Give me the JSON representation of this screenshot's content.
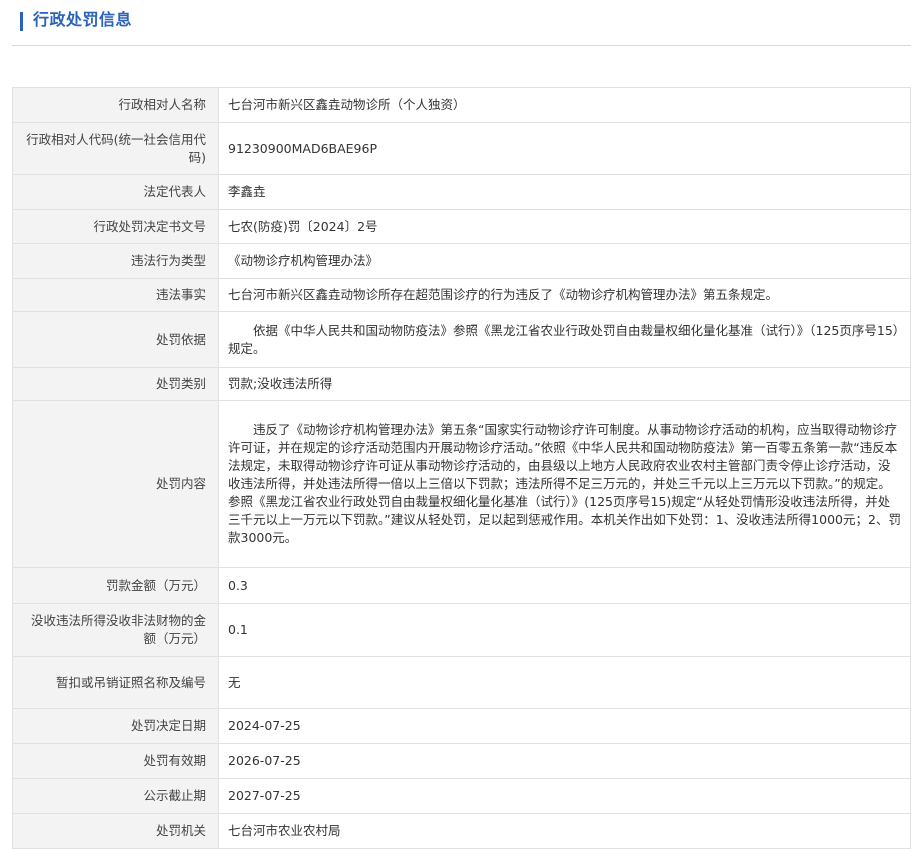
{
  "header": {
    "title": "行政处罚信息"
  },
  "rows": [
    {
      "label": "行政相对人名称",
      "value": "七台河市新兴区鑫垚动物诊所（个人独资）"
    },
    {
      "label": "行政相对人代码(统一社会信用代码)",
      "value": "91230900MAD6BAE96P"
    },
    {
      "label": "法定代表人",
      "value": "李鑫垚"
    },
    {
      "label": "行政处罚决定书文号",
      "value": "七农(防疫)罚〔2024〕2号"
    },
    {
      "label": "违法行为类型",
      "value": "《动物诊疗机构管理办法》"
    },
    {
      "label": "违法事实",
      "value": "七台河市新兴区鑫垚动物诊所存在超范围诊疗的行为违反了《动物诊疗机构管理办法》第五条规定。"
    },
    {
      "label": "处罚依据",
      "value": "依据《中华人民共和国动物防疫法》参照《黑龙江省农业行政处罚自由裁量权细化量化基准（试行）》（125页序号15）规定。"
    },
    {
      "label": "处罚类别",
      "value": "罚款;没收违法所得"
    },
    {
      "label": "处罚内容",
      "value": "违反了《动物诊疗机构管理办法》第五条“国家实行动物诊疗许可制度。从事动物诊疗活动的机构，应当取得动物诊疗许可证，并在规定的诊疗活动范围内开展动物诊疗活动。”依照《中华人民共和国动物防疫法》第一百零五条第一款“违反本法规定，未取得动物诊疗许可证从事动物诊疗活动的，由县级以上地方人民政府农业农村主管部门责令停止诊疗活动，没收违法所得，并处违法所得一倍以上三倍以下罚款；违法所得不足三万元的，并处三千元以上三万元以下罚款。”的规定。参照《黑龙江省农业行政处罚自由裁量权细化量化基准（试行）》(125页序号15)规定“从轻处罚情形没收违法所得，并处三千元以上一万元以下罚款。”建议从轻处罚，足以起到惩戒作用。本机关作出如下处罚：1、没收违法所得1000元；2、罚款3000元。"
    },
    {
      "label": "罚款金额（万元）",
      "value": "0.3"
    },
    {
      "label": "没收违法所得没收非法财物的金额（万元）",
      "value": "0.1"
    },
    {
      "label": "暂扣或吊销证照名称及编号",
      "value": "无"
    },
    {
      "label": "处罚决定日期",
      "value": "2024-07-25"
    },
    {
      "label": "处罚有效期",
      "value": "2026-07-25"
    },
    {
      "label": "公示截止期",
      "value": "2027-07-25"
    },
    {
      "label": "处罚机关",
      "value": "七台河市农业农村局"
    }
  ]
}
